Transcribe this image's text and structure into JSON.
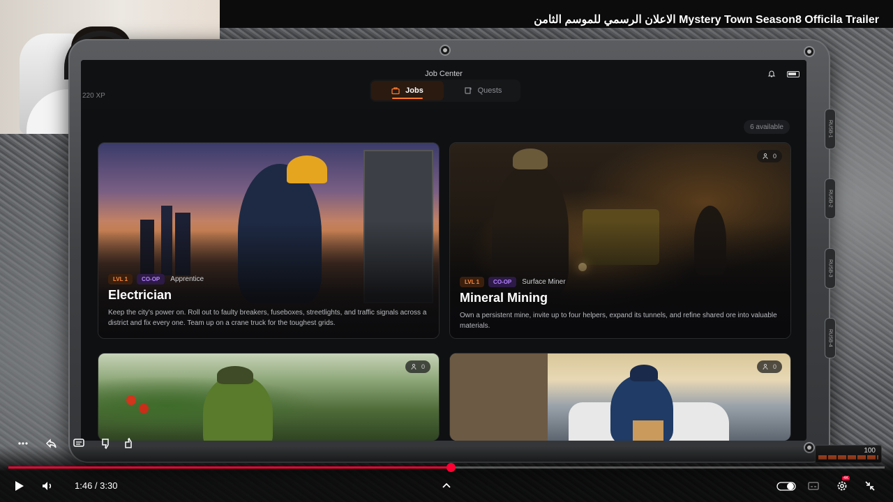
{
  "video": {
    "title": "الاعلان الرسمي للموسم الثامن Mystery Town Season8 Officila Trailer"
  },
  "app": {
    "title": "Job Center",
    "xp_text": "220 XP",
    "tabs": [
      {
        "label": "Jobs",
        "icon": "briefcase-icon",
        "active": true
      },
      {
        "label": "Quests",
        "icon": "scroll-icon",
        "active": false
      }
    ],
    "available_label": "6 available",
    "accent_color": "#ff7a2b"
  },
  "jobs": [
    {
      "title": "Electrician",
      "level": "LVL 1",
      "mode": "CO-OP",
      "rank": "Apprentice",
      "description": "Keep the city's power on. Roll out to faulty breakers, fuseboxes, streetlights, and traffic signals across a district and fix every one. Team up on a crane truck for the toughest grids.",
      "players": ""
    },
    {
      "title": "Mineral Mining",
      "level": "LVL 1",
      "mode": "CO-OP",
      "rank": "Surface Miner",
      "description": "Own a persistent mine, invite up to four helpers, expand its tunnels, and refine shared ore into valuable materials.",
      "players": "0"
    },
    {
      "players": "0"
    },
    {
      "players": "0"
    }
  ],
  "player": {
    "time": "1:46 / 3:30",
    "progress": 0.5048,
    "hud_value": "100",
    "quality_badge": "4K"
  }
}
